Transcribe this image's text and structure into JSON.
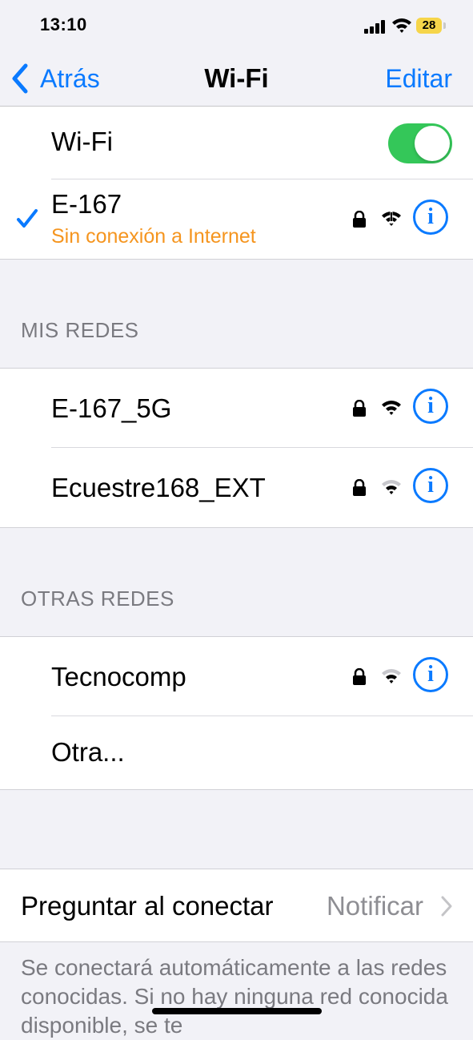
{
  "status_bar": {
    "time": "13:10",
    "battery_level": "28"
  },
  "nav": {
    "back_label": "Atrás",
    "title": "Wi-Fi",
    "edit_label": "Editar"
  },
  "wifi_toggle": {
    "label": "Wi-Fi",
    "state": "on"
  },
  "current_network": {
    "name": "E-167",
    "status": "Sin conexión a Internet"
  },
  "my_networks": {
    "header": "MIS REDES",
    "items": [
      {
        "name": "E-167_5G"
      },
      {
        "name": "Ecuestre168_EXT"
      }
    ]
  },
  "other_networks": {
    "header": "OTRAS REDES",
    "items": [
      {
        "name": "Tecnocomp"
      },
      {
        "name": "Otra..."
      }
    ]
  },
  "ask_to_join": {
    "label": "Preguntar al conectar",
    "value": "Notificar"
  },
  "footer_text": "Se conectará automáticamente a las redes conocidas. Si no hay ninguna red conocida disponible, se te",
  "colors": {
    "accent": "#0a7aff",
    "toggle_on": "#34c759",
    "warning": "#f5951f",
    "battery": "#f6d54a"
  }
}
